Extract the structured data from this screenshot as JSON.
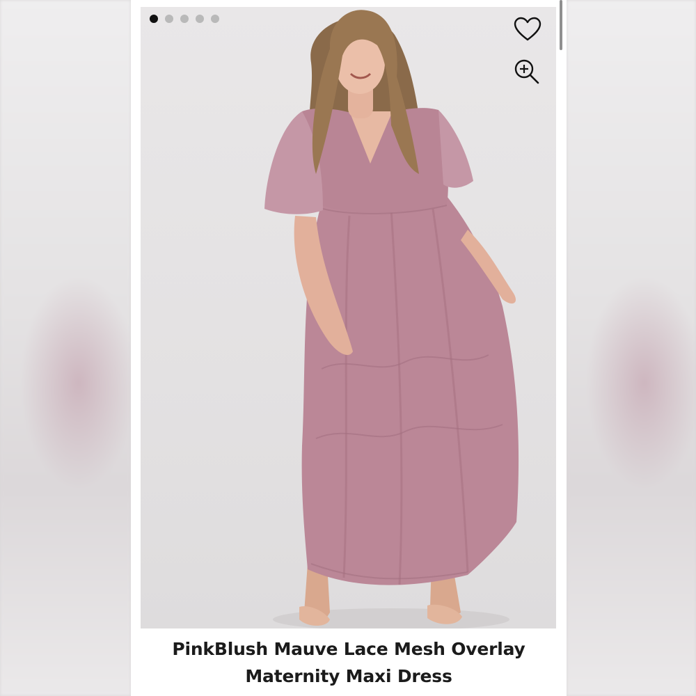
{
  "carousel": {
    "total_images": 5,
    "active_index": 0
  },
  "icons": {
    "favorite": "heart-icon",
    "zoom": "zoom-in-icon"
  },
  "product": {
    "title_line1": "PinkBlush Mauve Lace Mesh Overlay",
    "title_line2": "Maternity Maxi Dress"
  },
  "colors": {
    "dress": "#b98595",
    "accent_dot": "#111111",
    "inactive_dot": "#b9b9b9"
  }
}
